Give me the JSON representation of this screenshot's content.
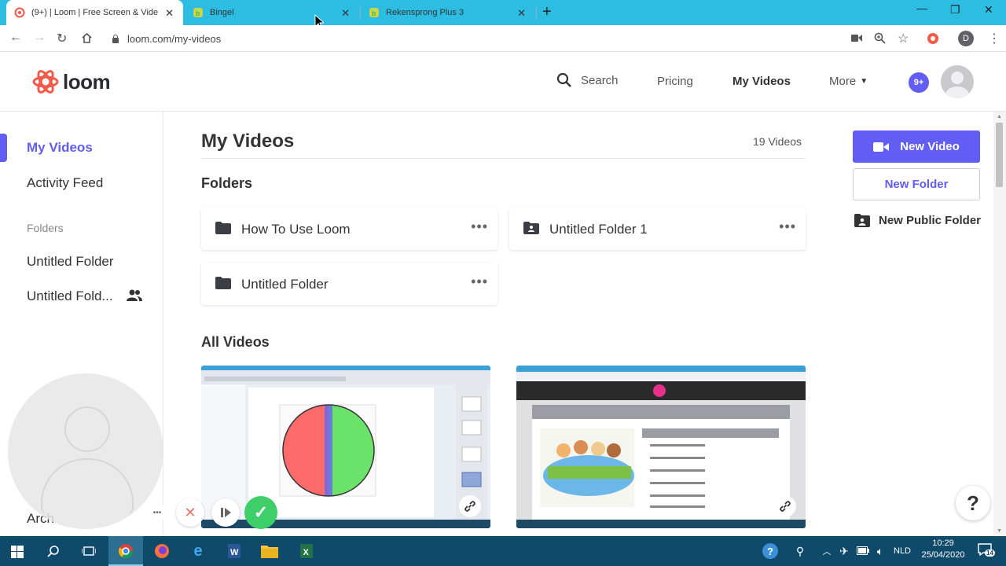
{
  "browser": {
    "tabs": [
      {
        "title": "(9+) | Loom | Free Screen & Vide"
      },
      {
        "title": "Bingel"
      },
      {
        "title": "Rekensprong Plus 3"
      }
    ],
    "url": "loom.com/my-videos",
    "profile_initial": "D"
  },
  "header": {
    "logo_text": "loom",
    "search_label": "Search",
    "nav": {
      "pricing": "Pricing",
      "my_videos": "My Videos",
      "more": "More"
    },
    "notifications_badge": "9+"
  },
  "sidebar": {
    "my_videos": "My Videos",
    "activity_feed": "Activity Feed",
    "folders_heading": "Folders",
    "folder_1": "Untitled Folder",
    "folder_2": "Untitled Fold...",
    "archive_partial": "Arch"
  },
  "main": {
    "title": "My Videos",
    "video_count": "19 Videos",
    "folders_title": "Folders",
    "folders": [
      {
        "name": "How To Use Loom"
      },
      {
        "name": "Untitled Folder 1"
      },
      {
        "name": "Untitled Folder"
      }
    ],
    "all_videos_title": "All Videos"
  },
  "actions": {
    "new_video": "New Video",
    "new_folder": "New Folder",
    "new_public_folder": "New Public Folder"
  },
  "help_label": "?",
  "taskbar": {
    "language": "NLD",
    "time": "10:29",
    "date": "25/04/2020",
    "notification_count": "14"
  },
  "colors": {
    "accent": "#625df5",
    "tabstrip": "#2dbde2",
    "taskbar": "#0f4a6b",
    "loom_logo": "#f15a49"
  }
}
